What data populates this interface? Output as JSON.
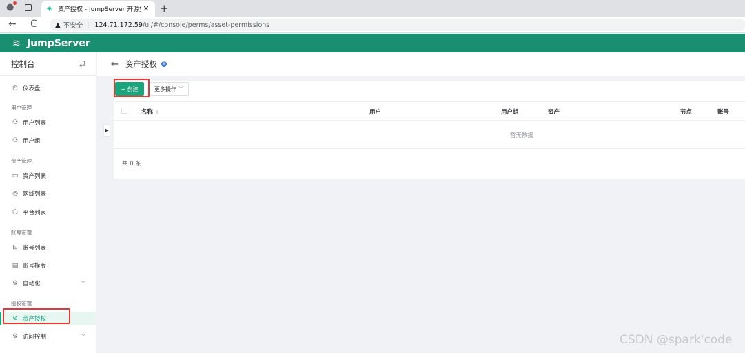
{
  "browser": {
    "tab_title": "资产授权 - JumpServer 开源堡垒...",
    "tab_close": "✕",
    "new_tab": "+",
    "back_icon": "←",
    "reload_icon": "C",
    "warn_icon": "▲",
    "insecure_label": "不安全",
    "separator": "|",
    "url_host": "124.71.172.59",
    "url_path": "/ui/#/console/perms/asset-permissions"
  },
  "header": {
    "logo_icon": "≋",
    "brand": "JumpServer"
  },
  "sidebar": {
    "title": "控制台",
    "swap_icon": "⇄",
    "items": {
      "dashboard": {
        "icon": "◴",
        "label": "仪表盘"
      },
      "group_user": "用户管理",
      "user_list": {
        "icon": "⚇",
        "label": "用户列表"
      },
      "user_group": {
        "icon": "⚇",
        "label": "用户组"
      },
      "group_asset": "资产管理",
      "asset_list": {
        "icon": "▭",
        "label": "资产列表"
      },
      "domain_list": {
        "icon": "◎",
        "label": "网域列表"
      },
      "platform_list": {
        "icon": "⬡",
        "label": "平台列表"
      },
      "group_account": "账号管理",
      "account_list": {
        "icon": "⊡",
        "label": "账号列表"
      },
      "account_template": {
        "icon": "▤",
        "label": "账号模版"
      },
      "automation": {
        "icon": "⚙",
        "label": "自动化",
        "chevron": "﹀"
      },
      "group_perm": "授权管理",
      "asset_perm": {
        "icon": "⊘",
        "label": "资产授权"
      },
      "access_control": {
        "icon": "⚙",
        "label": "访问控制",
        "chevron": "﹀"
      }
    }
  },
  "page": {
    "back_icon": "←",
    "title": "资产授权",
    "info_icon": "i",
    "collapse_icon": "▶",
    "create_button": "+ 创建",
    "more_button": "更多操作",
    "more_chevron": "﹀",
    "columns": {
      "name": "名称",
      "sort_icon": "⇕",
      "user": "用户",
      "user_group": "用户组",
      "asset": "资产",
      "node": "节点",
      "account": "账号"
    },
    "empty_text": "暂无数据",
    "total": "共 0 条"
  },
  "watermark": "CSDN @spark'code",
  "colors": {
    "brand": "#178f70",
    "accent": "#1aa57d",
    "highlight": "#e53935"
  }
}
